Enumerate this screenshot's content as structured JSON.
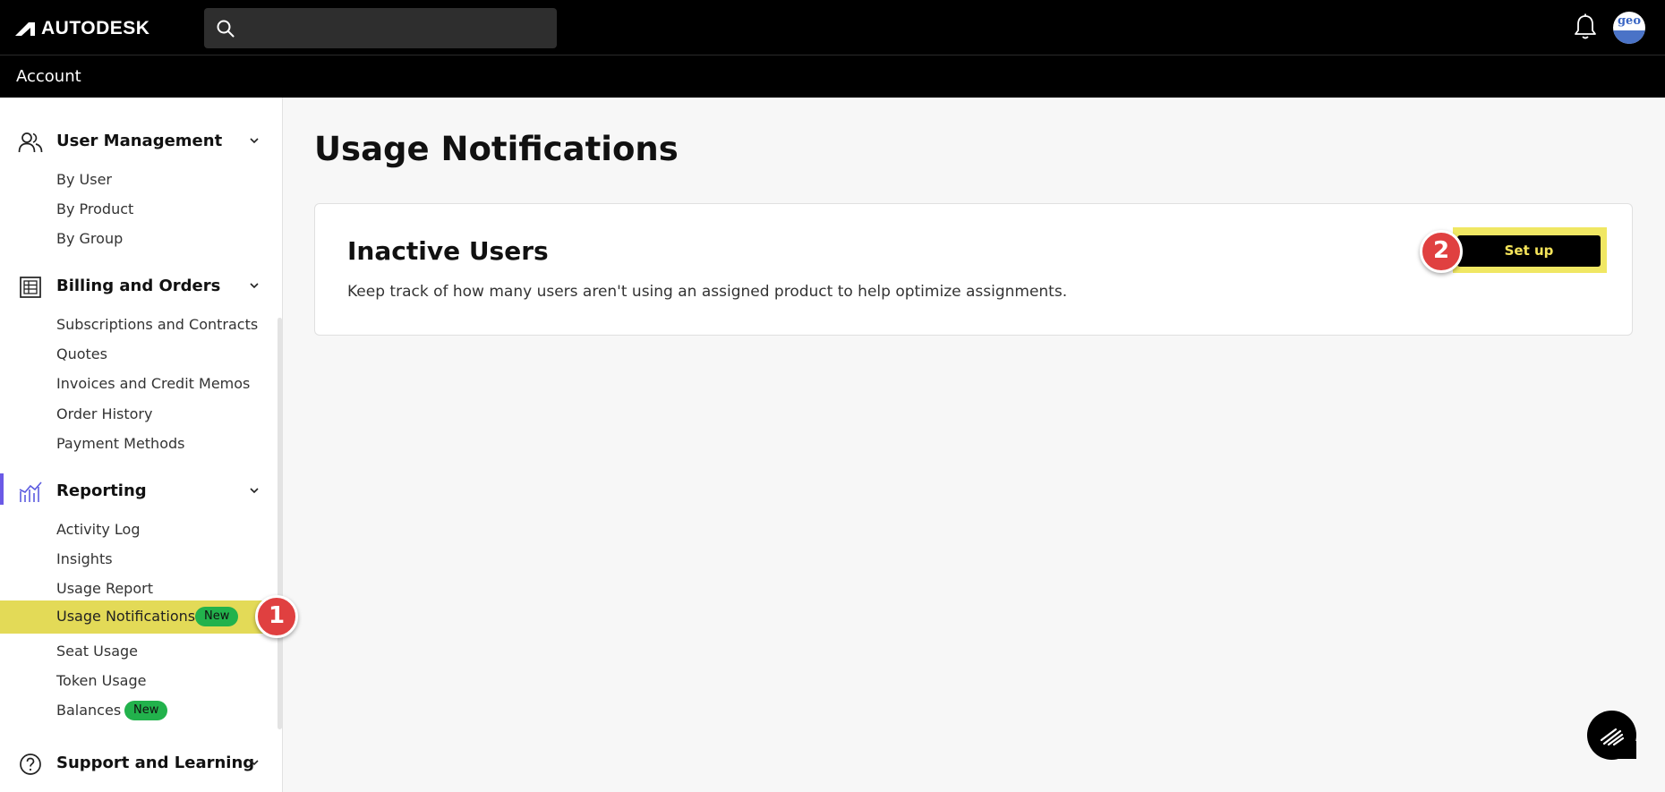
{
  "brand": {
    "name": "AUTODESK"
  },
  "header": {
    "search_placeholder": "",
    "avatar_text": "geo",
    "section_title": "Account"
  },
  "sidebar": {
    "sections": [
      {
        "label": "User Management",
        "icon": "users-icon",
        "items": [
          "By User",
          "By Product",
          "By Group"
        ]
      },
      {
        "label": "Billing and Orders",
        "icon": "billing-icon",
        "items": [
          "Subscriptions and Contracts",
          "Quotes",
          "Invoices and Credit Memos",
          "Order History",
          "Payment Methods"
        ]
      },
      {
        "label": "Reporting",
        "icon": "chart-icon",
        "items": [
          "Activity Log",
          "Insights",
          "Usage Report",
          "Usage Notifications",
          "Seat Usage",
          "Token Usage",
          "Balances"
        ]
      },
      {
        "label": "Support and Learning",
        "icon": "help-icon",
        "items": []
      }
    ],
    "badges": {
      "usage_notifications": "New",
      "balances": "New"
    }
  },
  "main": {
    "title": "Usage Notifications",
    "card": {
      "title": "Inactive Users",
      "description": "Keep track of how many users aren't using an assigned product to help optimize assignments.",
      "button_label": "Set up"
    }
  },
  "markers": [
    "1",
    "2"
  ],
  "colors": {
    "topbar": "#000000",
    "highlight": "#e3da57",
    "badge": "#22b24c",
    "marker": "#e04040",
    "active_indicator": "#6b5ae6",
    "button_text": "#f5e45a"
  }
}
